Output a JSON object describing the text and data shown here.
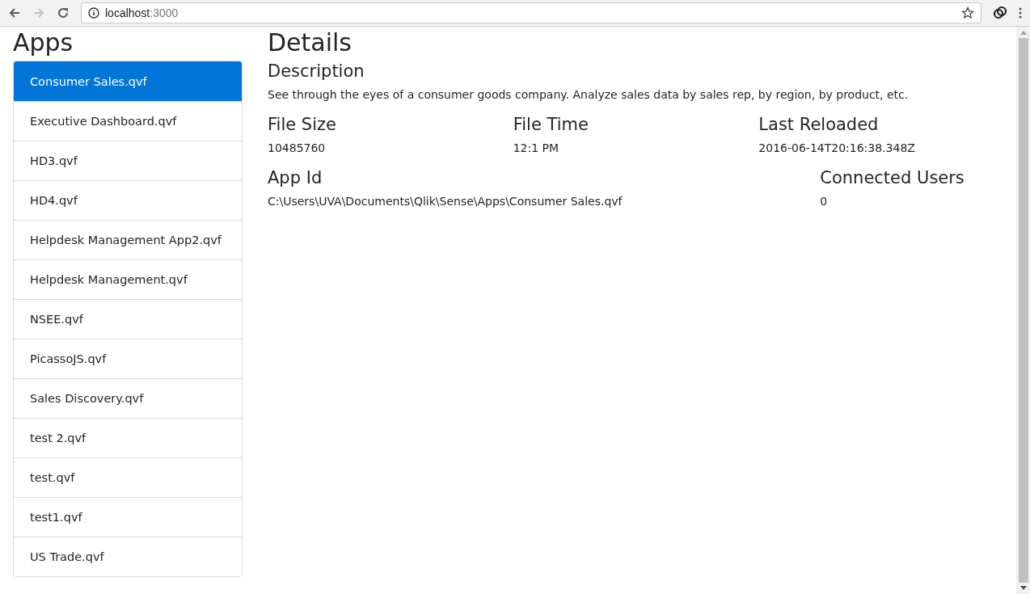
{
  "browser": {
    "url_host": "localhost",
    "url_port": ":3000"
  },
  "sidebar": {
    "title": "Apps",
    "items": [
      {
        "label": "Consumer Sales.qvf",
        "selected": true
      },
      {
        "label": "Executive Dashboard.qvf",
        "selected": false
      },
      {
        "label": "HD3.qvf",
        "selected": false
      },
      {
        "label": "HD4.qvf",
        "selected": false
      },
      {
        "label": "Helpdesk Management App2.qvf",
        "selected": false
      },
      {
        "label": "Helpdesk Management.qvf",
        "selected": false
      },
      {
        "label": "NSEE.qvf",
        "selected": false
      },
      {
        "label": "PicassoJS.qvf",
        "selected": false
      },
      {
        "label": "Sales Discovery.qvf",
        "selected": false
      },
      {
        "label": "test 2.qvf",
        "selected": false
      },
      {
        "label": "test.qvf",
        "selected": false
      },
      {
        "label": "test1.qvf",
        "selected": false
      },
      {
        "label": "US Trade.qvf",
        "selected": false
      }
    ]
  },
  "details": {
    "title": "Details",
    "description_heading": "Description",
    "description": "See through the eyes of a consumer goods company. Analyze sales data by sales rep, by region, by product, etc.",
    "fields_row_1": [
      {
        "heading": "File Size",
        "value": "10485760"
      },
      {
        "heading": "File Time",
        "value": "12:1 PM"
      },
      {
        "heading": "Last Reloaded",
        "value": "2016-06-14T20:16:38.348Z"
      }
    ],
    "fields_row_2": [
      {
        "heading": "App Id",
        "value": "C:\\Users\\UVA\\Documents\\Qlik\\Sense\\Apps\\Consumer Sales.qvf"
      },
      {
        "heading": "Connected Users",
        "value": "0"
      }
    ]
  }
}
